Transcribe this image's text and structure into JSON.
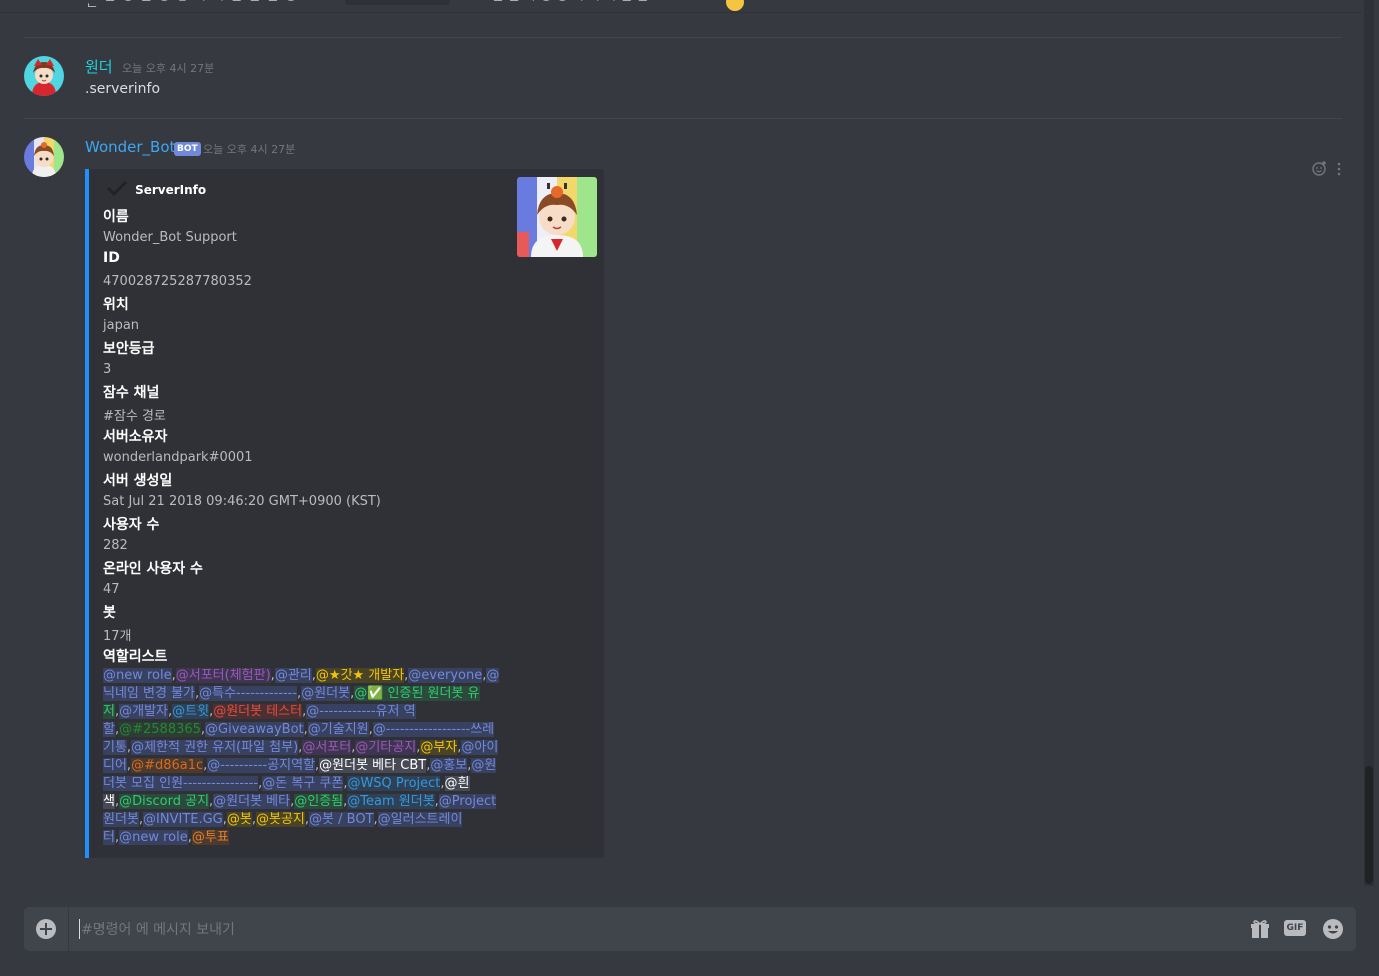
{
  "prev_message": {
    "fragment_left": "ᆫ ᄃ ᄋ ᄅ ᄋ ᄒ ᄀ ᄀ ᄃ ᄃ ᄅ ᄋ",
    "fragment_right": "ᄃ ᄅ ᄀ ᄋ ᄋ ᄀ ᄀ ᄀ ᄃ ᄃ"
  },
  "messages": [
    {
      "username": "원더",
      "timestamp": "오늘 오후 4시 27분",
      "text": ".serverinfo",
      "name_color": "#1fd3e0"
    },
    {
      "username": "Wonder_Bot",
      "bot_tag": "BOT",
      "timestamp": "오늘 오후 4시 27분",
      "name_color": "#3ba7f5"
    }
  ],
  "embed": {
    "accent_color": "#1e90ff",
    "author": "ServerInfo",
    "fields": [
      {
        "name": "이름",
        "value": "Wonder_Bot Support"
      },
      {
        "name": "ID",
        "value": "470028725287780352"
      },
      {
        "name": "위치",
        "value": "japan"
      },
      {
        "name": "보안등급",
        "value": "3"
      },
      {
        "name": "잠수 채널",
        "value": "#잠수 경로"
      },
      {
        "name": "서버소유자",
        "value": "wonderlandpark#0001"
      },
      {
        "name": "서버 생성일",
        "value": "Sat Jul 21 2018 09:46:20 GMT+0900 (KST)"
      },
      {
        "name": "사용자 수",
        "value": "282"
      },
      {
        "name": "온라인 사용자 수",
        "value": "47"
      },
      {
        "name": "봇",
        "value": "17개"
      },
      {
        "name": "역할리스트",
        "value": ""
      }
    ],
    "roles": [
      {
        "text": "@new role",
        "color": "#7289da",
        "bg": "#394160"
      },
      {
        "text": "@서포터(체험판)",
        "color": "#9b59b6",
        "bg": "#3e3552"
      },
      {
        "text": "@관리",
        "color": "#7289da",
        "bg": "#394160"
      },
      {
        "text": "@★갓★ 개발자",
        "color": "#f1c40f",
        "bg": "#4a4426"
      },
      {
        "text": "@everyone",
        "color": "#7289da",
        "bg": "#394160"
      },
      {
        "text": "@닉네임 변경 불가",
        "color": "#7289da",
        "bg": "#394160"
      },
      {
        "text": "@특수-------------",
        "color": "#7289da",
        "bg": "#394160"
      },
      {
        "text": "@원더봇",
        "color": "#7289da",
        "bg": "#394160"
      },
      {
        "text": "@✅ 인증된 원더봇 유저",
        "color": "#2ecc71",
        "bg": "#2b4a3b"
      },
      {
        "text": "@개발자",
        "color": "#7289da",
        "bg": "#394160"
      },
      {
        "text": "@트윗",
        "color": "#3498db",
        "bg": "#2e4157"
      },
      {
        "text": "@원더봇 테스터",
        "color": "#e74c3c",
        "bg": "#4a3033"
      },
      {
        "text": "@------------유저 역할",
        "color": "#7289da",
        "bg": "#394160"
      },
      {
        "text": "@#2588365",
        "color": "#258836",
        "bg": "#2c3d33"
      },
      {
        "text": "@GiveawayBot",
        "color": "#7289da",
        "bg": "#394160"
      },
      {
        "text": "@기술지원",
        "color": "#7289da",
        "bg": "#394160"
      },
      {
        "text": "@------------------쓰레기통",
        "color": "#7289da",
        "bg": "#394160"
      },
      {
        "text": "@제한적 권한 유저(파일 첨부)",
        "color": "#7289da",
        "bg": "#394160"
      },
      {
        "text": "@서포터",
        "color": "#9b59b6",
        "bg": "#3e3552"
      },
      {
        "text": "@기타공지",
        "color": "#9b59b6",
        "bg": "#3e3552"
      },
      {
        "text": "@부자",
        "color": "#f1c40f",
        "bg": "#4a4426"
      },
      {
        "text": "@아이디어",
        "color": "#7289da",
        "bg": "#394160"
      },
      {
        "text": "@#d86a1c",
        "color": "#d86a1c",
        "bg": "#4a3a30"
      },
      {
        "text": "@----------공지역할",
        "color": "#7289da",
        "bg": "#394160"
      },
      {
        "text": "@원더봇 베타 CBT",
        "color": "#ffffff",
        "bg": "#464a55"
      },
      {
        "text": "@홍보",
        "color": "#7289da",
        "bg": "#394160"
      },
      {
        "text": "@원더봇 모집 인원----------------",
        "color": "#7289da",
        "bg": "#394160"
      },
      {
        "text": "@돈 복구 쿠폰",
        "color": "#7289da",
        "bg": "#394160"
      },
      {
        "text": "@WSQ Project",
        "color": "#3498db",
        "bg": "#2e4157"
      },
      {
        "text": "@흰색",
        "color": "#ffffff",
        "bg": "#464a55"
      },
      {
        "text": "@Discord 공지",
        "color": "#2ecc71",
        "bg": "#2b4a3b"
      },
      {
        "text": "@원더봇 베타",
        "color": "#7289da",
        "bg": "#394160"
      },
      {
        "text": "@인증됨",
        "color": "#2ecc71",
        "bg": "#2b4a3b"
      },
      {
        "text": "@Team 원더봇",
        "color": "#3498db",
        "bg": "#2e4157"
      },
      {
        "text": "@Project 원더봇",
        "color": "#7289da",
        "bg": "#394160"
      },
      {
        "text": "@INVITE.GG",
        "color": "#7289da",
        "bg": "#394160"
      },
      {
        "text": "@봇",
        "color": "#f1c40f",
        "bg": "#4a4426"
      },
      {
        "text": "@봇공지",
        "color": "#f1c40f",
        "bg": "#4a4426"
      },
      {
        "text": "@봇 / BOT",
        "color": "#7289da",
        "bg": "#394160"
      },
      {
        "text": "@일러스트레이터",
        "color": "#7289da",
        "bg": "#394160"
      },
      {
        "text": "@new role",
        "color": "#7289da",
        "bg": "#394160"
      },
      {
        "text": "@투표",
        "color": "#e67e22",
        "bg": "#4a3a30"
      }
    ]
  },
  "input": {
    "placeholder": "#명령어 에 메시지 보내기",
    "gif_label": "GIF"
  },
  "icons": [
    "add-reaction-icon",
    "more-options-icon",
    "plus-icon",
    "gift-icon",
    "gif-icon",
    "emoji-icon",
    "check-icon"
  ]
}
